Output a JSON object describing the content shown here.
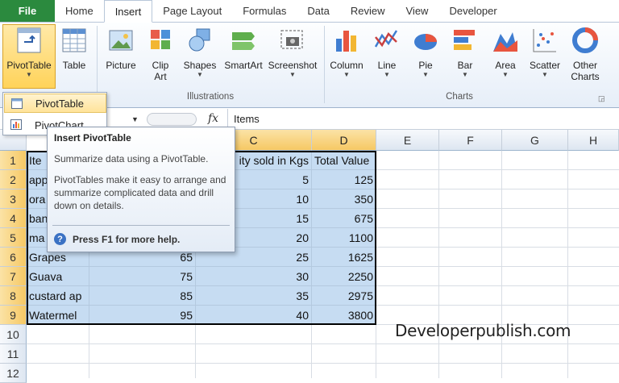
{
  "tabs": [
    "File",
    "Home",
    "Insert",
    "Page Layout",
    "Formulas",
    "Data",
    "Review",
    "View",
    "Developer"
  ],
  "active_tab": "Insert",
  "ribbon": {
    "pivottable": "PivotTable",
    "table": "Table",
    "picture": "Picture",
    "clip_art_1": "Clip",
    "clip_art_2": "Art",
    "shapes": "Shapes",
    "smartart": "SmartArt",
    "screenshot": "Screenshot",
    "column": "Column",
    "line": "Line",
    "pie": "Pie",
    "bar": "Bar",
    "area": "Area",
    "scatter": "Scatter",
    "other_1": "Other",
    "other_2": "Charts",
    "group_illustrations": "Illustrations",
    "group_charts": "Charts"
  },
  "menu": {
    "pivottable": "PivotTable",
    "pivotchart": "PivotChart"
  },
  "formula_bar": {
    "fx": "fx",
    "value": "Items"
  },
  "tooltip": {
    "title": "Insert PivotTable",
    "line1": "Summarize data using a PivotTable.",
    "line2": "PivotTables make it easy to arrange and summarize complicated data and drill down on details.",
    "help": "Press F1 for more help."
  },
  "columns": [
    "C",
    "D",
    "E",
    "F",
    "G",
    "H"
  ],
  "rows": [
    "1",
    "2",
    "3",
    "4",
    "5",
    "6",
    "7",
    "8",
    "9",
    "10",
    "11",
    "12"
  ],
  "cells": {
    "a1": "Ite",
    "a2": "app",
    "a3": "ora",
    "a4": "ban",
    "a5": "ma",
    "a6": "Grapes",
    "a7": "Guava",
    "a8": "custard ap",
    "a9": "Watermel",
    "b6": "65",
    "b7": "75",
    "b8": "85",
    "b9": "95",
    "c1": "ity sold in Kgs",
    "d1": "Total Value",
    "c2": "5",
    "c3": "10",
    "c4": "15",
    "c5": "20",
    "c6": "25",
    "c7": "30",
    "c8": "35",
    "c9": "40",
    "d2": "125",
    "d3": "350",
    "d4": "675",
    "d5": "1100",
    "d6": "1625",
    "d7": "2250",
    "d8": "2975",
    "d9": "3800"
  },
  "watermark": "Developerpublish.com",
  "colors": {
    "file_tab": "#2b8a3e",
    "selection": "#c6dcf2",
    "header_selected": "#f6c864"
  }
}
